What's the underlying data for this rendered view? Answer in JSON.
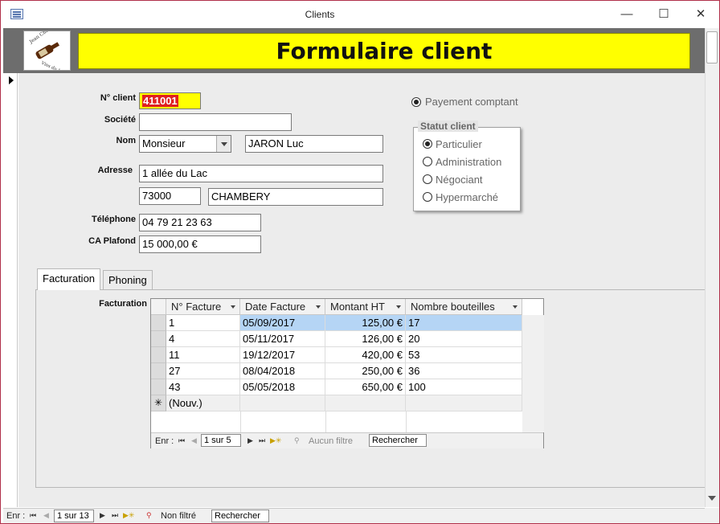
{
  "window": {
    "title": "Clients",
    "minimize": "—",
    "maximize": "☐",
    "close": "✕"
  },
  "logo": {
    "line1": "Jean Chalon",
    "line2": "Vins du Jura"
  },
  "header": {
    "title": "Formulaire client"
  },
  "form": {
    "client_no_label": "N° client",
    "client_no": "411001",
    "societe_label": "Société",
    "societe": "",
    "nom_label": "Nom",
    "civilite": "Monsieur",
    "nom": "JARON Luc",
    "adresse_label": "Adresse",
    "adresse": "1 allée du Lac",
    "cp": "73000",
    "ville": "CHAMBERY",
    "telephone_label": "Téléphone",
    "telephone": "04 79 21 23 63",
    "ca_label": "CA Plafond",
    "ca": "15 000,00 €",
    "payement_label": "Payement comptant",
    "payement_checked": true
  },
  "statut": {
    "title": "Statut client",
    "options": [
      {
        "label": "Particulier",
        "selected": true
      },
      {
        "label": "Administration",
        "selected": false
      },
      {
        "label": "Négociant",
        "selected": false
      },
      {
        "label": "Hypermarché",
        "selected": false
      }
    ]
  },
  "tabs": [
    {
      "label": "Facturation",
      "active": true
    },
    {
      "label": "Phoning",
      "active": false
    }
  ],
  "subform": {
    "label": "Facturation",
    "columns": [
      "N° Facture",
      "Date Facture",
      "Montant HT",
      "Nombre bouteilles"
    ],
    "rows": [
      [
        "1",
        "05/09/2017",
        "125,00 €",
        "17"
      ],
      [
        "4",
        "05/11/2017",
        "126,00 €",
        "20"
      ],
      [
        "11",
        "19/12/2017",
        "420,00 €",
        "53"
      ],
      [
        "27",
        "08/04/2018",
        "250,00 €",
        "36"
      ],
      [
        "43",
        "05/05/2018",
        "650,00 €",
        "100"
      ]
    ],
    "new_row_marker": "✳",
    "new_row_label": "(Nouv.)",
    "nav": {
      "label": "Enr :",
      "position": "1 sur 5",
      "filter": "Aucun filtre",
      "search": "Rechercher"
    }
  },
  "main_nav": {
    "label": "Enr :",
    "position": "1 sur 13",
    "filter": "Non filtré",
    "search": "Rechercher"
  },
  "nav_icons": {
    "first": "⏮",
    "prev": "◀",
    "next": "▶",
    "last": "⏭",
    "new": "▶✳",
    "funnel": "⚲"
  }
}
